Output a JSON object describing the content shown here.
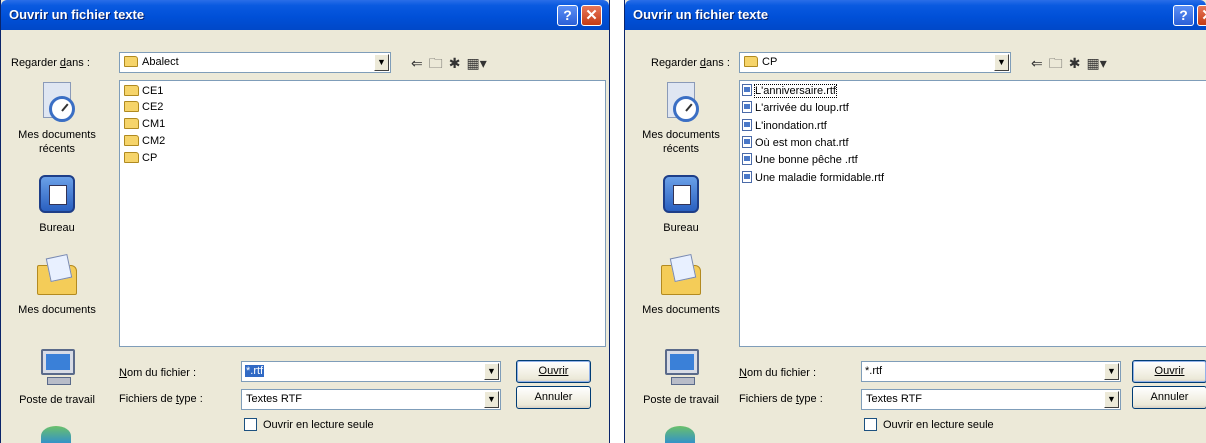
{
  "dialogs": [
    {
      "title": "Ouvrir un fichier texte",
      "look_in_label": "Regarder dans :",
      "look_in_value": "Abalect",
      "places": [
        "Mes documents récents",
        "Bureau",
        "Mes documents",
        "Poste de travail"
      ],
      "items": [
        "CE1",
        "CE2",
        "CM1",
        "CM2",
        "CP"
      ],
      "item_type": "folder",
      "filename_label": "Nom du fichier :",
      "filename_value": "*.rtf",
      "filetype_label": "Fichiers de type :",
      "filetype_value": "Textes RTF",
      "open_button": "Ouvrir",
      "cancel_button": "Annuler",
      "readonly_label": "Ouvrir en lecture seule"
    },
    {
      "title": "Ouvrir un fichier texte",
      "look_in_label": "Regarder dans :",
      "look_in_value": "CP",
      "places": [
        "Mes documents récents",
        "Bureau",
        "Mes documents",
        "Poste de travail"
      ],
      "items": [
        "L'anniversaire.rtf",
        "L'arrivée du loup.rtf",
        "L'inondation.rtf",
        "Où est mon chat.rtf",
        "Une bonne pêche .rtf",
        "Une maladie formidable.rtf"
      ],
      "item_type": "rtf",
      "filename_label": "Nom du fichier :",
      "filename_value": "*.rtf",
      "filetype_label": "Fichiers de type :",
      "filetype_value": "Textes RTF",
      "open_button": "Ouvrir",
      "cancel_button": "Annuler",
      "readonly_label": "Ouvrir en lecture seule"
    }
  ],
  "title_buttons": {
    "help": "?",
    "close": "✕"
  },
  "toolbar_icons": [
    "back-arrow-icon",
    "up-folder-icon",
    "new-folder-icon",
    "view-menu-icon"
  ],
  "colors": {
    "titlebar": "#0050d8",
    "dialog_bg": "#ece9d8",
    "selection": "#316ac5"
  }
}
